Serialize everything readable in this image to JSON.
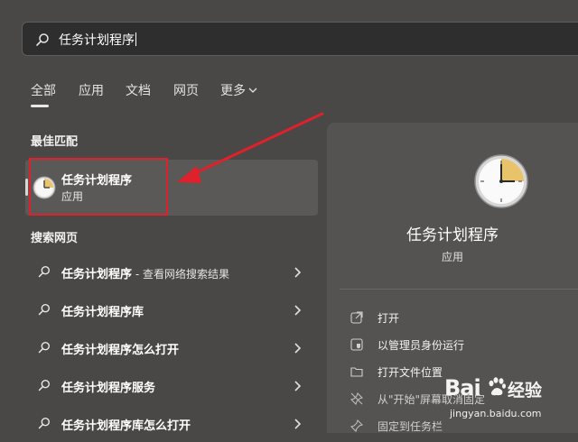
{
  "search": {
    "query": "任务计划程序"
  },
  "tabs": [
    "全部",
    "应用",
    "文档",
    "网页",
    "更多"
  ],
  "sections": {
    "best_match": "最佳匹配",
    "search_web": "搜索网页"
  },
  "best_match": {
    "name": "任务计划程序",
    "type": "应用"
  },
  "web_results": [
    {
      "bold": "任务计划程序",
      "suffix": " - 查看网络搜索结果"
    },
    {
      "bold": "任务计划程序库",
      "suffix": ""
    },
    {
      "bold": "任务计划程序怎么打开",
      "suffix": ""
    },
    {
      "bold": "任务计划程序服务",
      "suffix": ""
    },
    {
      "bold": "任务计划程序库怎么打开",
      "suffix": ""
    }
  ],
  "detail": {
    "title": "任务计划程序",
    "subtitle": "应用",
    "actions": [
      "打开",
      "以管理员身份运行",
      "打开文件位置",
      "从\"开始\"屏幕取消固定",
      "固定到任务栏"
    ]
  },
  "watermark": {
    "brand": "Bai",
    "brand2": "经验",
    "url": "jingyan.baidu.com"
  },
  "colors": {
    "background": "#4a4847",
    "panel": "#555352",
    "selected": "#5b5958",
    "annotation_red": "#e0202a"
  }
}
